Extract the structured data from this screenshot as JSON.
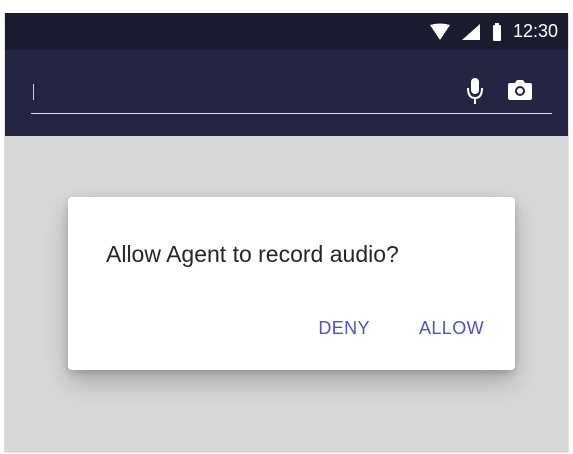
{
  "status_bar": {
    "time": "12:30",
    "icons": [
      "wifi-icon",
      "signal-icon",
      "battery-icon"
    ]
  },
  "search_bar": {
    "icons": [
      "mic-icon",
      "camera-icon"
    ]
  },
  "dialog": {
    "message": "Allow Agent to record audio?",
    "deny_label": "DENY",
    "allow_label": "ALLOW"
  },
  "colors": {
    "status_bar": "#1b1b2f",
    "toolbar": "#242542",
    "background": "#d8d8d8",
    "dialog_button": "#4f4fd0"
  }
}
